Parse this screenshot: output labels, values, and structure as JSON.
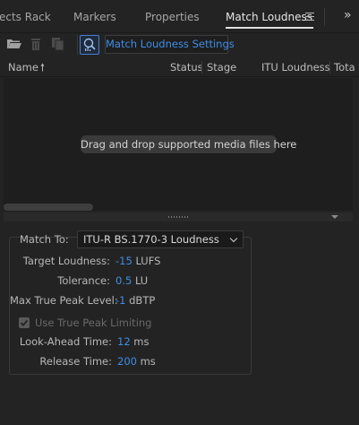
{
  "tabs": [
    {
      "label": "ects Rack",
      "active": false
    },
    {
      "label": "Markers",
      "active": false
    },
    {
      "label": "Properties",
      "active": false
    },
    {
      "label": "Match Loudness",
      "active": true
    }
  ],
  "toolbar": {
    "settings_label": "Match Loudness Settings"
  },
  "columns": [
    "Name",
    "Status",
    "Stage",
    "ITU Loudness",
    "Tota"
  ],
  "list": {
    "drop_hint": "Drag and drop supported media files here"
  },
  "settings": {
    "match_to_label": "Match To:",
    "match_to_value": "ITU-R BS.1770-3 Loudness",
    "target_loudness_label": "Target Loudness:",
    "target_loudness_value": "-15",
    "target_loudness_unit": "LUFS",
    "tolerance_label": "Tolerance:",
    "tolerance_value": "0.5",
    "tolerance_unit": "LU",
    "max_peak_label": "Max True Peak Level:",
    "max_peak_value": "-1",
    "max_peak_unit": "dBTP",
    "true_peak_limiting_label": "Use True Peak Limiting",
    "true_peak_limiting_checked": true,
    "lookahead_label": "Look-Ahead Time:",
    "lookahead_value": "12",
    "lookahead_unit": "ms",
    "release_label": "Release Time:",
    "release_value": "200",
    "release_unit": "ms"
  },
  "colors": {
    "accent": "#3f8ee6",
    "background": "#232323"
  }
}
